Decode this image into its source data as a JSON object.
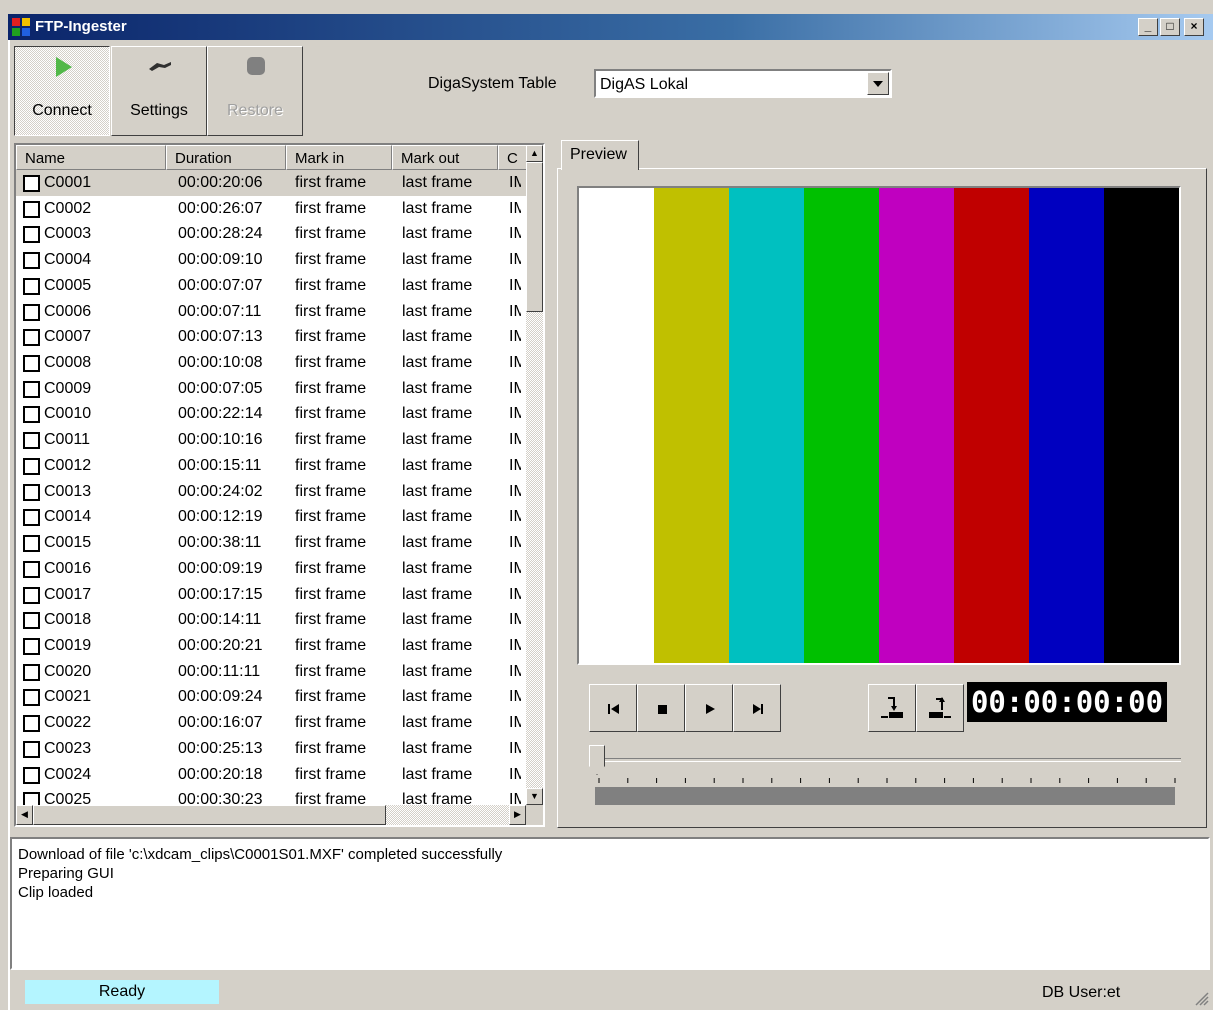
{
  "window": {
    "title": "FTP-Ingester",
    "controls": [
      "_",
      "□",
      "×"
    ]
  },
  "toolbar": {
    "connect_label": "Connect",
    "settings_label": "Settings",
    "restore_label": "Restore"
  },
  "digas": {
    "label": "DigaSystem Table",
    "value": "DigAS Lokal"
  },
  "clip_list": {
    "columns": [
      "Name",
      "Duration",
      "Mark in",
      "Mark out",
      "C"
    ],
    "rows": [
      {
        "name": "C0001",
        "duration": "00:00:20:06",
        "mark_in": "first frame",
        "mark_out": "last frame",
        "c": "IM"
      },
      {
        "name": "C0002",
        "duration": "00:00:26:07",
        "mark_in": "first frame",
        "mark_out": "last frame",
        "c": "IM"
      },
      {
        "name": "C0003",
        "duration": "00:00:28:24",
        "mark_in": "first frame",
        "mark_out": "last frame",
        "c": "IM"
      },
      {
        "name": "C0004",
        "duration": "00:00:09:10",
        "mark_in": "first frame",
        "mark_out": "last frame",
        "c": "IM"
      },
      {
        "name": "C0005",
        "duration": "00:00:07:07",
        "mark_in": "first frame",
        "mark_out": "last frame",
        "c": "IM"
      },
      {
        "name": "C0006",
        "duration": "00:00:07:11",
        "mark_in": "first frame",
        "mark_out": "last frame",
        "c": "IM"
      },
      {
        "name": "C0007",
        "duration": "00:00:07:13",
        "mark_in": "first frame",
        "mark_out": "last frame",
        "c": "IM"
      },
      {
        "name": "C0008",
        "duration": "00:00:10:08",
        "mark_in": "first frame",
        "mark_out": "last frame",
        "c": "IM"
      },
      {
        "name": "C0009",
        "duration": "00:00:07:05",
        "mark_in": "first frame",
        "mark_out": "last frame",
        "c": "IM"
      },
      {
        "name": "C0010",
        "duration": "00:00:22:14",
        "mark_in": "first frame",
        "mark_out": "last frame",
        "c": "IM"
      },
      {
        "name": "C0011",
        "duration": "00:00:10:16",
        "mark_in": "first frame",
        "mark_out": "last frame",
        "c": "IM"
      },
      {
        "name": "C0012",
        "duration": "00:00:15:11",
        "mark_in": "first frame",
        "mark_out": "last frame",
        "c": "IM"
      },
      {
        "name": "C0013",
        "duration": "00:00:24:02",
        "mark_in": "first frame",
        "mark_out": "last frame",
        "c": "IM"
      },
      {
        "name": "C0014",
        "duration": "00:00:12:19",
        "mark_in": "first frame",
        "mark_out": "last frame",
        "c": "IM"
      },
      {
        "name": "C0015",
        "duration": "00:00:38:11",
        "mark_in": "first frame",
        "mark_out": "last frame",
        "c": "IM"
      },
      {
        "name": "C0016",
        "duration": "00:00:09:19",
        "mark_in": "first frame",
        "mark_out": "last frame",
        "c": "IM"
      },
      {
        "name": "C0017",
        "duration": "00:00:17:15",
        "mark_in": "first frame",
        "mark_out": "last frame",
        "c": "IM"
      },
      {
        "name": "C0018",
        "duration": "00:00:14:11",
        "mark_in": "first frame",
        "mark_out": "last frame",
        "c": "IM"
      },
      {
        "name": "C0019",
        "duration": "00:00:20:21",
        "mark_in": "first frame",
        "mark_out": "last frame",
        "c": "IM"
      },
      {
        "name": "C0020",
        "duration": "00:00:11:11",
        "mark_in": "first frame",
        "mark_out": "last frame",
        "c": "IM"
      },
      {
        "name": "C0021",
        "duration": "00:00:09:24",
        "mark_in": "first frame",
        "mark_out": "last frame",
        "c": "IM"
      },
      {
        "name": "C0022",
        "duration": "00:00:16:07",
        "mark_in": "first frame",
        "mark_out": "last frame",
        "c": "IM"
      },
      {
        "name": "C0023",
        "duration": "00:00:25:13",
        "mark_in": "first frame",
        "mark_out": "last frame",
        "c": "IM"
      },
      {
        "name": "C0024",
        "duration": "00:00:20:18",
        "mark_in": "first frame",
        "mark_out": "last frame",
        "c": "IM"
      },
      {
        "name": "C0025",
        "duration": "00:00:30:23",
        "mark_in": "first frame",
        "mark_out": "last frame",
        "c": "IM"
      }
    ]
  },
  "preview": {
    "tab_label": "Preview",
    "color_bars": [
      "#ffffff",
      "#c0c000",
      "#00c0c0",
      "#00c000",
      "#c000c0",
      "#c00000",
      "#0000c0",
      "#000000"
    ],
    "timecode": "00:00:00:00",
    "position": 0
  },
  "log": {
    "lines": [
      "Download of file 'c:\\xdcam_clips\\C0001S01.MXF' completed successfully",
      "Preparing GUI",
      "Clip loaded"
    ]
  },
  "status": {
    "ready": "Ready",
    "db_user": "DB User:et"
  }
}
